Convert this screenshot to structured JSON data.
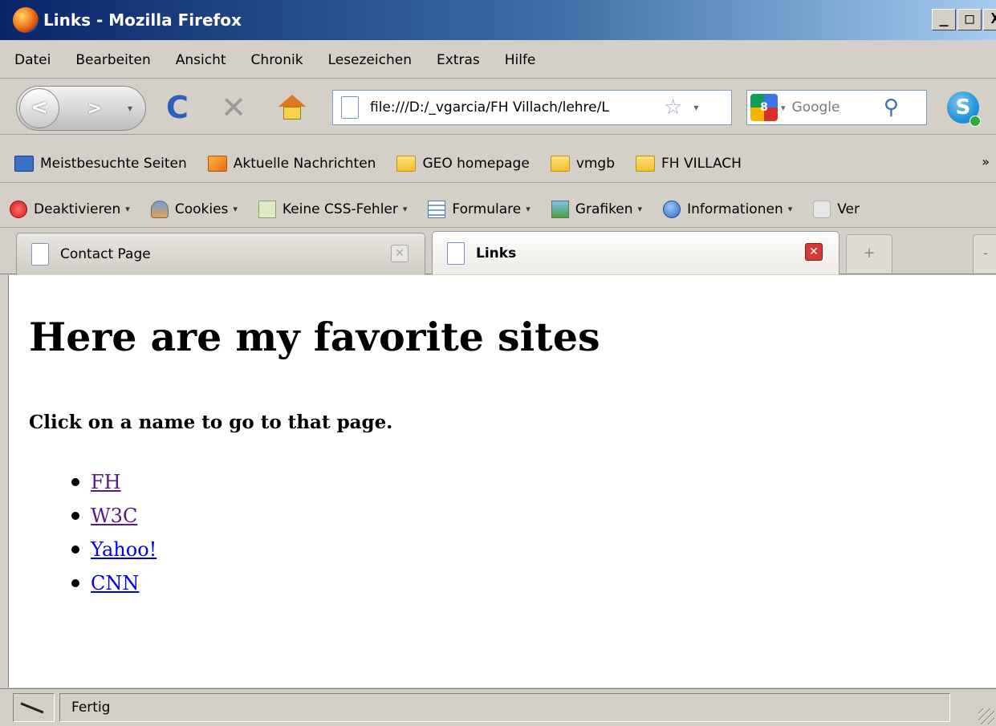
{
  "window": {
    "title": "Links - Mozilla Firefox",
    "controls": {
      "minimize": "_",
      "maximize": "□",
      "close": "X"
    }
  },
  "menu": {
    "items": [
      "Datei",
      "Bearbeiten",
      "Ansicht",
      "Chronik",
      "Lesezeichen",
      "Extras",
      "Hilfe"
    ]
  },
  "navigation": {
    "back_label": "<",
    "forward_label": ">",
    "history_caret": "▾",
    "reload_glyph": "C",
    "stop_glyph": "✕",
    "address": "file:///D:/_vgarcia/FH Villach/lehre/L",
    "search_placeholder": "Google",
    "search_engine_glyph": "8",
    "skype_glyph": "S"
  },
  "bookmarks": {
    "items": [
      {
        "label": "Meistbesuchte Seiten",
        "icon": "smart-folder-icon"
      },
      {
        "label": "Aktuelle Nachrichten",
        "icon": "rss-feed-icon"
      },
      {
        "label": "GEO homepage",
        "icon": "folder-icon"
      },
      {
        "label": "vmgb",
        "icon": "folder-icon"
      },
      {
        "label": "FH VILLACH",
        "icon": "folder-icon"
      }
    ],
    "overflow": "»"
  },
  "dev_toolbar": {
    "items": [
      {
        "label": "Deaktivieren",
        "icon": "disable-icon"
      },
      {
        "label": "Cookies",
        "icon": "cookies-icon"
      },
      {
        "label": "Keine CSS-Fehler",
        "icon": "css-icon"
      },
      {
        "label": "Formulare",
        "icon": "forms-icon"
      },
      {
        "label": "Grafiken",
        "icon": "images-icon"
      },
      {
        "label": "Informationen",
        "icon": "info-icon"
      },
      {
        "label": "Ver",
        "icon": "resize-icon"
      }
    ],
    "caret": "▾"
  },
  "tabs": {
    "items": [
      {
        "label": "Contact Page",
        "active": false
      },
      {
        "label": "Links",
        "active": true
      }
    ],
    "close_glyph": "✕",
    "new_tab_glyph": "+",
    "list_glyph": "-"
  },
  "page": {
    "heading": "Here are my favorite sites",
    "subheading": "Click on a name to go to that page.",
    "links": [
      {
        "label": "FH",
        "visited": true
      },
      {
        "label": "W3C",
        "visited": true
      },
      {
        "label": "Yahoo!",
        "visited": false
      },
      {
        "label": "CNN",
        "visited": false
      }
    ]
  },
  "status": {
    "text": "Fertig"
  },
  "colors": {
    "visited_link": "#551a8b",
    "unvisited_link": "#0000ee",
    "titlebar_start": "#0a246a",
    "titlebar_end": "#a6caf0"
  }
}
